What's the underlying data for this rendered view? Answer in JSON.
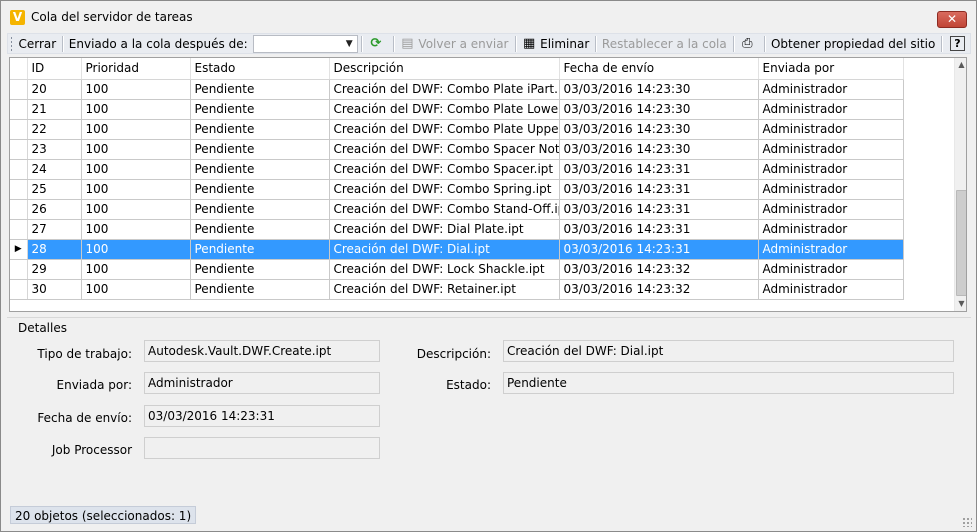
{
  "window": {
    "title": "Cola del servidor de tareas",
    "app_icon_letter": "V",
    "close_glyph": "✕"
  },
  "toolbar": {
    "close_label": "Cerrar",
    "sent_after_label": "Enviado a la cola después de:",
    "sent_after_value": "",
    "resubmit_label": "Volver a enviar",
    "delete_label": "Eliminar",
    "reset_label": "Restablecer a la cola",
    "site_property_label": "Obtener propiedad del sitio",
    "help_label": "?"
  },
  "grid": {
    "columns": [
      "ID",
      "Prioridad",
      "Estado",
      "Descripción",
      "Fecha de envío",
      "Enviada por"
    ],
    "rows": [
      {
        "id": "20",
        "priority": "100",
        "state": "Pendiente",
        "description": "Creación del DWF: Combo Plate iPart.ipt",
        "date": "03/03/2016 14:23:30",
        "by": "Administrador"
      },
      {
        "id": "21",
        "priority": "100",
        "state": "Pendiente",
        "description": "Creación del DWF: Combo Plate Lower.ipt",
        "date": "03/03/2016 14:23:30",
        "by": "Administrador"
      },
      {
        "id": "22",
        "priority": "100",
        "state": "Pendiente",
        "description": "Creación del DWF: Combo Plate Upper.ipt",
        "date": "03/03/2016 14:23:30",
        "by": "Administrador"
      },
      {
        "id": "23",
        "priority": "100",
        "state": "Pendiente",
        "description": "Creación del DWF: Combo Spacer Notch…",
        "date": "03/03/2016 14:23:30",
        "by": "Administrador"
      },
      {
        "id": "24",
        "priority": "100",
        "state": "Pendiente",
        "description": "Creación del DWF: Combo Spacer.ipt",
        "date": "03/03/2016 14:23:31",
        "by": "Administrador"
      },
      {
        "id": "25",
        "priority": "100",
        "state": "Pendiente",
        "description": "Creación del DWF: Combo Spring.ipt",
        "date": "03/03/2016 14:23:31",
        "by": "Administrador"
      },
      {
        "id": "26",
        "priority": "100",
        "state": "Pendiente",
        "description": "Creación del DWF: Combo Stand-Off.ipt",
        "date": "03/03/2016 14:23:31",
        "by": "Administrador"
      },
      {
        "id": "27",
        "priority": "100",
        "state": "Pendiente",
        "description": "Creación del DWF: Dial Plate.ipt",
        "date": "03/03/2016 14:23:31",
        "by": "Administrador"
      },
      {
        "id": "28",
        "priority": "100",
        "state": "Pendiente",
        "description": "Creación del DWF: Dial.ipt",
        "date": "03/03/2016 14:23:31",
        "by": "Administrador",
        "selected": true
      },
      {
        "id": "29",
        "priority": "100",
        "state": "Pendiente",
        "description": "Creación del DWF: Lock Shackle.ipt",
        "date": "03/03/2016 14:23:32",
        "by": "Administrador"
      },
      {
        "id": "30",
        "priority": "100",
        "state": "Pendiente",
        "description": "Creación del DWF: Retainer.ipt",
        "date": "03/03/2016 14:23:32",
        "by": "Administrador"
      }
    ]
  },
  "details": {
    "title": "Detalles",
    "job_type_label": "Tipo de trabajo:",
    "job_type_value": "Autodesk.Vault.DWF.Create.ipt",
    "sent_by_label": "Enviada por:",
    "sent_by_value": "Administrador",
    "date_label": "Fecha de envío:",
    "date_value": "03/03/2016 14:23:31",
    "job_processor_label": "Job Processor",
    "job_processor_value": "",
    "description_label": "Descripción:",
    "description_value": "Creación del DWF: Dial.ipt",
    "state_label": "Estado:",
    "state_value": "Pendiente"
  },
  "status": {
    "text": "20 objetos (seleccionados: 1)"
  },
  "colors": {
    "selection": "#3399ff",
    "brand_icon": "#f5b400"
  }
}
